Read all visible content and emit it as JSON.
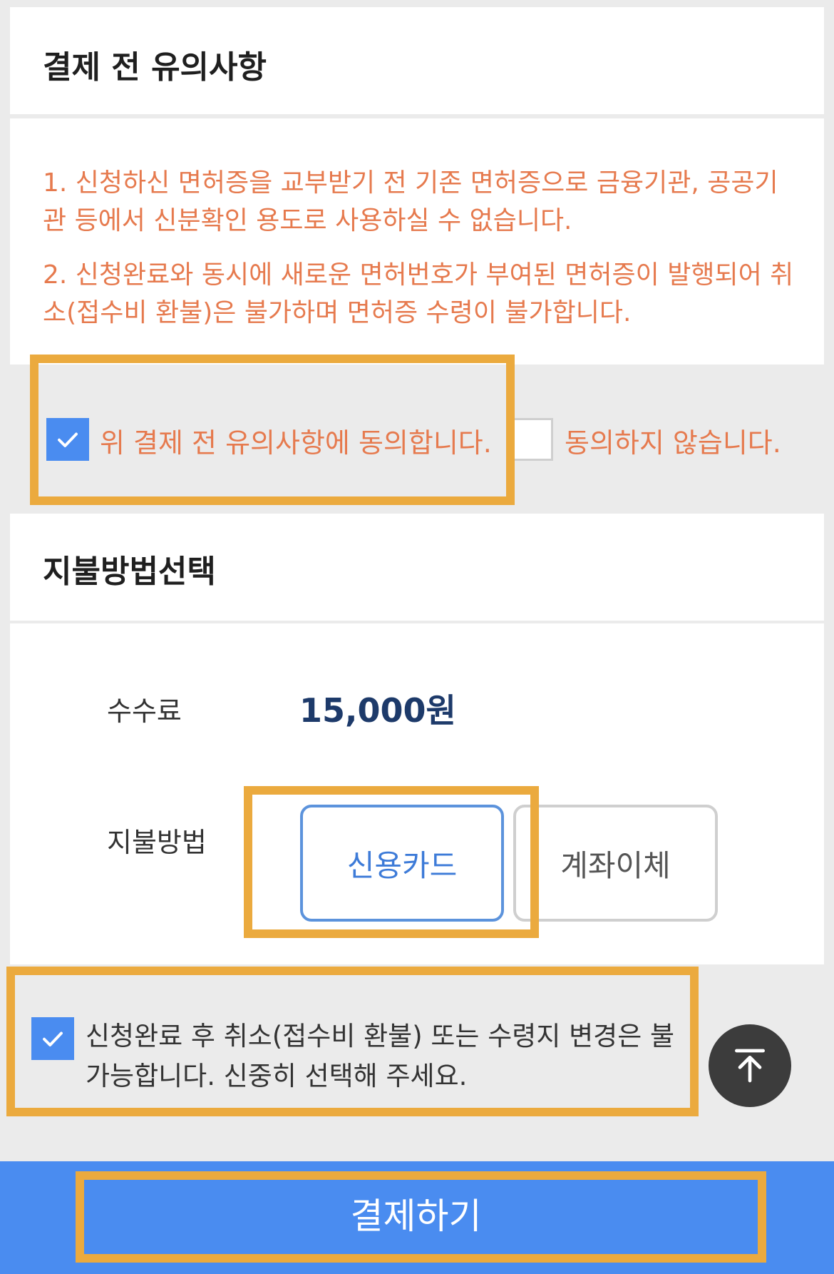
{
  "notice_section": {
    "title": "결제 전 유의사항",
    "item1": "1. 신청하신 면허증을 교부받기 전 기존 면허증으로 금융기관, 공공기관 등에서 신분확인 용도로 사용하실 수 없습니다.",
    "item2": "2. 신청완료와 동시에 새로운 면허번호가 부여된 면허증이 발행되어 취소(접수비 환불)은 불가하며 면허증 수령이 불가합니다."
  },
  "agreement": {
    "agree_label": "위 결제 전 유의사항에 동의합니다.",
    "agree_checked": true,
    "disagree_label": "동의하지 않습니다.",
    "disagree_checked": false
  },
  "payment_section": {
    "title": "지불방법선택",
    "fee_label": "수수료",
    "fee_value": "15,000원",
    "method_label": "지불방법",
    "methods": [
      "신용카드",
      "계좌이체"
    ],
    "selected_method": "신용카드"
  },
  "confirm": {
    "text": "신청완료 후 취소(접수비 환불) 또는 수령지 변경은 불가능합니다. 신중히 선택해 주세요.",
    "checked": true
  },
  "scroll_top": {
    "icon": "arrow-up-to-top-icon"
  },
  "submit": {
    "label": "결제하기"
  },
  "colors": {
    "accent": "#4a8cf0",
    "notice_text": "#e67a4e",
    "highlight": "#ebaa3e",
    "fee_text": "#1d3a6a"
  }
}
